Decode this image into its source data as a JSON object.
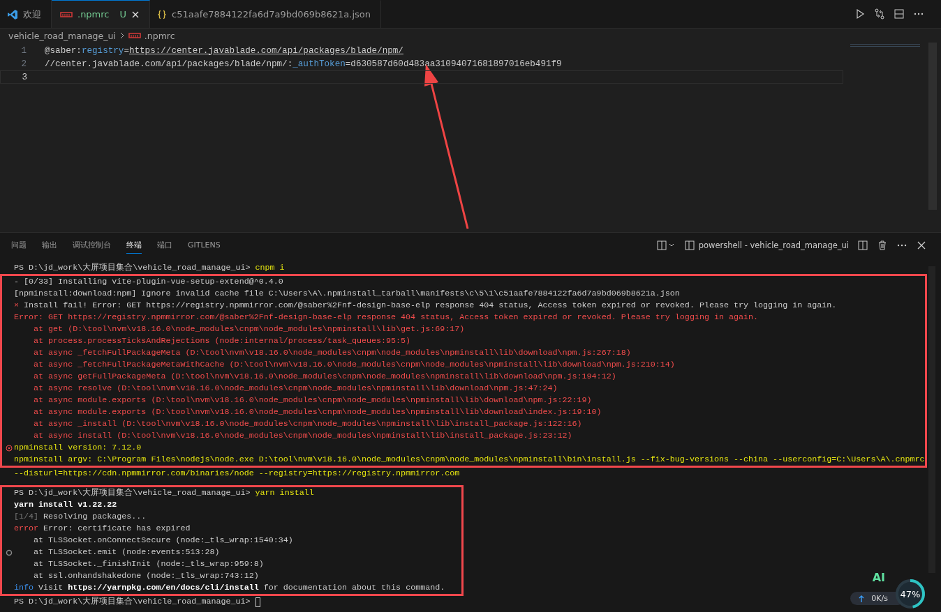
{
  "tabs": [
    {
      "label": "欢迎",
      "kind": "welcome",
      "selected": false
    },
    {
      "label": ".npmrc",
      "kind": "npmrc",
      "selected": true,
      "status": "U"
    },
    {
      "label": "c51aafe7884122fa6d7a9bd069b8621a.json",
      "kind": "json",
      "selected": false
    }
  ],
  "breadcrumb": [
    {
      "label": "vehicle_road_manage_ui",
      "kind": "folder"
    },
    {
      "label": ".npmrc",
      "kind": "npmrc"
    }
  ],
  "editor": {
    "lines": [
      {
        "number": "1",
        "current": false,
        "arrow": false,
        "segments": [
          {
            "kind": "plain",
            "text": "@saber:"
          },
          {
            "kind": "key",
            "text": "registry"
          },
          {
            "kind": "plain",
            "text": "="
          },
          {
            "kind": "link",
            "text": "https://center.javablade.com/api/packages/blade/npm/"
          }
        ]
      },
      {
        "number": "2",
        "current": false,
        "arrow": true,
        "segments": [
          {
            "kind": "plain",
            "text": "//center.javablade.com/api/packages/blade/npm/:"
          },
          {
            "kind": "key",
            "text": "_authToken"
          },
          {
            "kind": "plain",
            "text": "=d630587d60d483aa31094071681897016eb491f9"
          }
        ]
      },
      {
        "number": "3",
        "current": true,
        "arrow": false
      }
    ]
  },
  "panel": {
    "tabs": [
      {
        "label": "问题",
        "selected": false
      },
      {
        "label": "输出",
        "selected": false
      },
      {
        "label": "调试控制台",
        "selected": false
      },
      {
        "label": "终端",
        "selected": true
      },
      {
        "label": "端口",
        "selected": false
      },
      {
        "label": "GITLENS",
        "selected": false
      }
    ],
    "terminal_title": "powershell - vehicle_road_manage_ui"
  },
  "terminal": {
    "blocks": [
      {
        "highlighted": false,
        "lines": [
          {
            "kind": "plain",
            "segments": [
              {
                "kind": "plain",
                "text": "PS D:\\jd_work\\大屏项目集合\\vehicle_road_manage_ui> "
              },
              {
                "kind": "command",
                "text": "cnpm i"
              }
            ]
          }
        ]
      },
      {
        "highlighted": true,
        "lines": [
          {
            "kind": "plain",
            "segments": [
              {
                "kind": "plain",
                "text": "- [0/33] Installing vite-plugin-vue-setup-extend@^0.4.0"
              }
            ]
          },
          {
            "kind": "plain",
            "segments": [
              {
                "kind": "plain",
                "text": "[npminstall:download:npm] Ignore invalid cache file C:\\Users\\A\\.npminstall_tarball\\manifests\\c\\5\\1\\c51aafe7884122fa6d7a9bd069b8621a.json"
              }
            ]
          },
          {
            "kind": "plain",
            "segments": [
              {
                "kind": "error",
                "text": "× "
              },
              {
                "kind": "plain",
                "text": "Install fail! Error: GET https://registry.npmmirror.com/@saber%2Fnf-design-base-elp response 404 status, Access token expired or revoked. Please try logging in again."
              }
            ]
          },
          {
            "kind": "plain",
            "segments": [
              {
                "kind": "error",
                "text": "Error: GET https://registry.npmmirror.com/@saber%2Fnf-design-base-elp response 404 status, Access token expired or revoked. Please try logging in again."
              }
            ]
          },
          {
            "kind": "plain",
            "segments": [
              {
                "kind": "error",
                "text": "    at get (D:\\tool\\nvm\\v18.16.0\\node_modules\\cnpm\\node_modules\\npminstall\\lib\\get.js:69:17)"
              }
            ]
          },
          {
            "kind": "plain",
            "segments": [
              {
                "kind": "error",
                "text": "    at process.processTicksAndRejections (node:internal/process/task_queues:95:5)"
              }
            ]
          },
          {
            "kind": "plain",
            "segments": [
              {
                "kind": "error",
                "text": "    at async _fetchFullPackageMeta (D:\\tool\\nvm\\v18.16.0\\node_modules\\cnpm\\node_modules\\npminstall\\lib\\download\\npm.js:267:18)"
              }
            ]
          },
          {
            "kind": "plain",
            "segments": [
              {
                "kind": "error",
                "text": "    at async _fetchFullPackageMetaWithCache (D:\\tool\\nvm\\v18.16.0\\node_modules\\cnpm\\node_modules\\npminstall\\lib\\download\\npm.js:210:14)"
              }
            ]
          },
          {
            "kind": "plain",
            "segments": [
              {
                "kind": "error",
                "text": "    at async getFullPackageMeta (D:\\tool\\nvm\\v18.16.0\\node_modules\\cnpm\\node_modules\\npminstall\\lib\\download\\npm.js:194:12)"
              }
            ]
          },
          {
            "kind": "plain",
            "segments": [
              {
                "kind": "error",
                "text": "    at async resolve (D:\\tool\\nvm\\v18.16.0\\node_modules\\cnpm\\node_modules\\npminstall\\lib\\download\\npm.js:47:24)"
              }
            ]
          },
          {
            "kind": "plain",
            "segments": [
              {
                "kind": "error",
                "text": "    at async module.exports (D:\\tool\\nvm\\v18.16.0\\node_modules\\cnpm\\node_modules\\npminstall\\lib\\download\\npm.js:22:19)"
              }
            ]
          },
          {
            "kind": "plain",
            "segments": [
              {
                "kind": "error",
                "text": "    at async module.exports (D:\\tool\\nvm\\v18.16.0\\node_modules\\cnpm\\node_modules\\npminstall\\lib\\download\\index.js:19:10)"
              }
            ]
          },
          {
            "kind": "plain",
            "segments": [
              {
                "kind": "error",
                "text": "    at async _install (D:\\tool\\nvm\\v18.16.0\\node_modules\\cnpm\\node_modules\\npminstall\\lib\\install_package.js:122:16)"
              }
            ]
          },
          {
            "kind": "plain",
            "segments": [
              {
                "kind": "error",
                "text": "    at async install (D:\\tool\\nvm\\v18.16.0\\node_modules\\cnpm\\node_modules\\npminstall\\lib\\install_package.js:23:12)"
              }
            ]
          },
          {
            "kind": "failed",
            "segments": [
              {
                "kind": "command",
                "text": "npminstall version: 7.12.0"
              }
            ]
          },
          {
            "kind": "plain",
            "segments": [
              {
                "kind": "command",
                "text": "npminstall argv: C:\\Program Files\\nodejs\\node.exe D:\\tool\\nvm\\v18.16.0\\node_modules\\cnpm\\node_modules\\npminstall\\bin\\install.js --fix-bug-versions --china --userconfig=C:\\Users\\A\\.cnpmrc"
              }
            ]
          }
        ]
      },
      {
        "highlighted": false,
        "lines": [
          {
            "kind": "plain",
            "segments": [
              {
                "kind": "command",
                "text": "--disturl=https://cdn.npmmirror.com/binaries/node --registry=https://registry.npmmirror.com"
              }
            ]
          }
        ]
      },
      {
        "highlighted": true,
        "lines": [
          {
            "kind": "plain",
            "segments": [
              {
                "kind": "plain",
                "text": "PS D:\\jd_work\\大屏项目集合\\vehicle_road_manage_ui> "
              },
              {
                "kind": "command",
                "text": "yarn install"
              }
            ]
          },
          {
            "kind": "plain",
            "segments": [
              {
                "kind": "bold",
                "text": "yarn install v1.22.22"
              }
            ]
          },
          {
            "kind": "plain",
            "segments": [
              {
                "kind": "dim",
                "text": "[1/4]"
              },
              {
                "kind": "plain",
                "text": " Resolving packages..."
              }
            ]
          },
          {
            "kind": "plain",
            "segments": [
              {
                "kind": "error",
                "text": "error"
              },
              {
                "kind": "plain",
                "text": " Error: certificate has expired"
              }
            ]
          },
          {
            "kind": "plain",
            "segments": [
              {
                "kind": "plain",
                "text": "    at TLSSocket.onConnectSecure (node:_tls_wrap:1540:34)"
              }
            ]
          },
          {
            "kind": "finished",
            "segments": [
              {
                "kind": "plain",
                "text": "    at TLSSocket.emit (node:events:513:28)"
              }
            ]
          },
          {
            "kind": "plain",
            "segments": [
              {
                "kind": "plain",
                "text": "    at TLSSocket._finishInit (node:_tls_wrap:959:8)"
              }
            ]
          },
          {
            "kind": "plain",
            "segments": [
              {
                "kind": "plain",
                "text": "    at ssl.onhandshakedone (node:_tls_wrap:743:12)"
              }
            ]
          },
          {
            "kind": "plain",
            "segments": [
              {
                "kind": "info",
                "text": "info"
              },
              {
                "kind": "plain",
                "text": " Visit "
              },
              {
                "kind": "bold",
                "text": "https://yarnpkg.com/en/docs/cli/install"
              },
              {
                "kind": "plain",
                "text": " for documentation about this command."
              }
            ]
          }
        ]
      },
      {
        "highlighted": false,
        "lines": [
          {
            "kind": "prompt",
            "segments": [
              {
                "kind": "plain",
                "text": "PS D:\\jd_work\\大屏项目集合\\vehicle_road_manage_ui> "
              }
            ]
          }
        ]
      }
    ]
  },
  "widget": {
    "badge": "AI",
    "speed": "0K/s",
    "percent": "47%",
    "level": 0.47
  }
}
